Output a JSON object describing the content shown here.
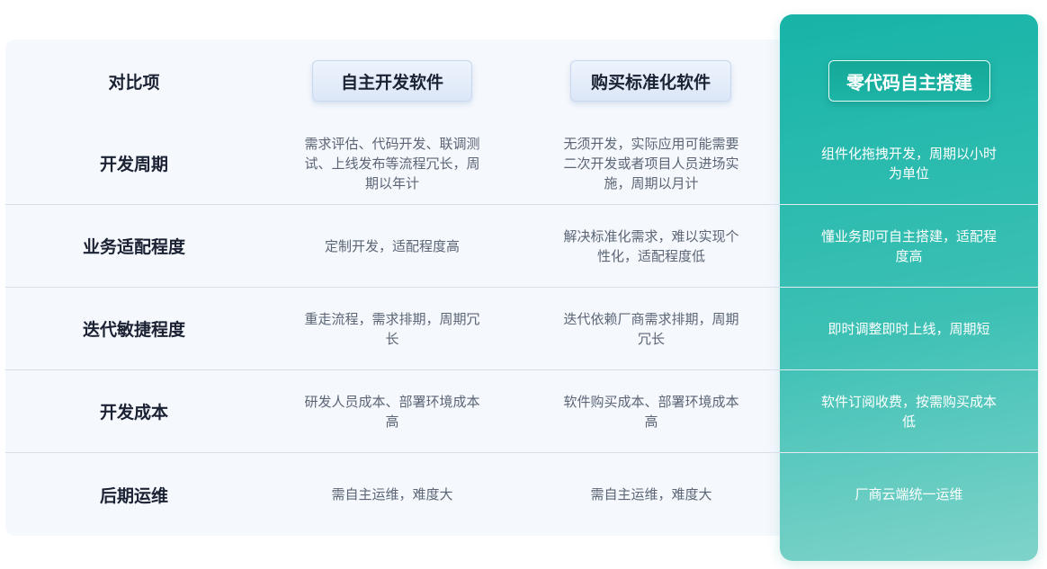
{
  "header": {
    "label_col": "对比项",
    "col_self_dev": "自主开发软件",
    "col_standard": "购买标准化软件",
    "col_zero_code": "零代码自主搭建"
  },
  "rows": [
    {
      "label": "开发周期",
      "self_dev": "需求评估、代码开发、联调测试、上线发布等流程冗长，周期以年计",
      "standard": "无须开发，实际应用可能需要二次开发或者项目人员进场实施，周期以月计",
      "zero_code": "组件化拖拽开发，周期以小时为单位"
    },
    {
      "label": "业务适配程度",
      "self_dev": "定制开发，适配程度高",
      "standard": "解决标准化需求，难以实现个性化，适配程度低",
      "zero_code": "懂业务即可自主搭建，适配程度高"
    },
    {
      "label": "迭代敏捷程度",
      "self_dev": "重走流程，需求排期，周期冗长",
      "standard": "迭代依赖厂商需求排期，周期冗长",
      "zero_code": "即时调整即时上线，周期短"
    },
    {
      "label": "开发成本",
      "self_dev": "研发人员成本、部署环境成本高",
      "standard": "软件购买成本、部署环境成本高",
      "zero_code": "软件订阅收费，按需购买成本低"
    },
    {
      "label": "后期运维",
      "self_dev": "需自主运维，难度大",
      "standard": "需自主运维，难度大",
      "zero_code": "厂商云端统一运维"
    }
  ]
}
